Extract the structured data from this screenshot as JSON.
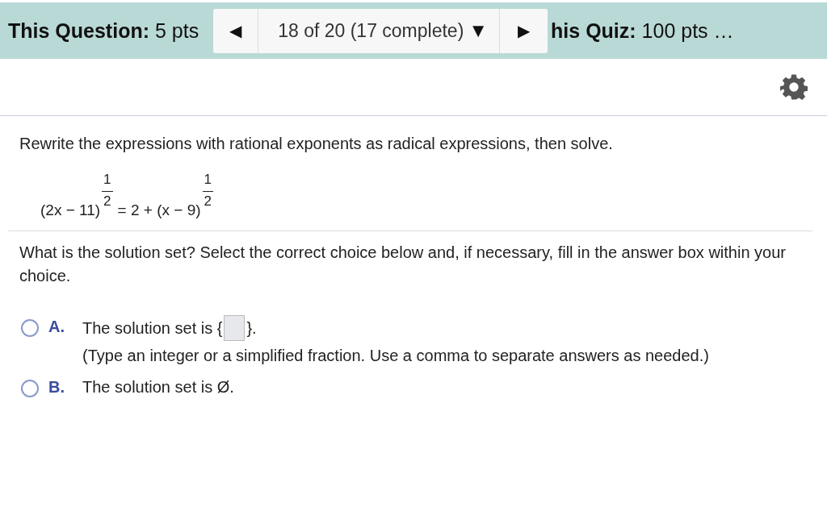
{
  "header": {
    "question_label": "This Question:",
    "question_points": "5 pts",
    "prev": "◀",
    "position": "18 of 20 (17 complete)",
    "dropdown": "▼",
    "next": "▶",
    "quiz_label": "his Quiz:",
    "quiz_points": "100 pts …"
  },
  "instruction": "Rewrite the expressions with rational exponents as radical expressions, then solve.",
  "equation": [
    {
      "base": "(2x − 11)",
      "num": "1",
      "den": "2"
    },
    {
      "base": "= 2 + (x − 9)",
      "num": "1",
      "den": "2"
    }
  ],
  "prompt": "What is the solution set? Select the correct choice below and, if necessary, fill in the answer box within your choice.",
  "choices": [
    {
      "kind": "input",
      "letter": "A.",
      "before": "The solution set is {",
      "after": "}.",
      "hint": "(Type an integer or a simplified fraction. Use a comma to separate answers as needed.)",
      "selected": false
    },
    {
      "kind": "text",
      "letter": "B.",
      "before": "The solution set is Ø.",
      "selected": false
    }
  ]
}
